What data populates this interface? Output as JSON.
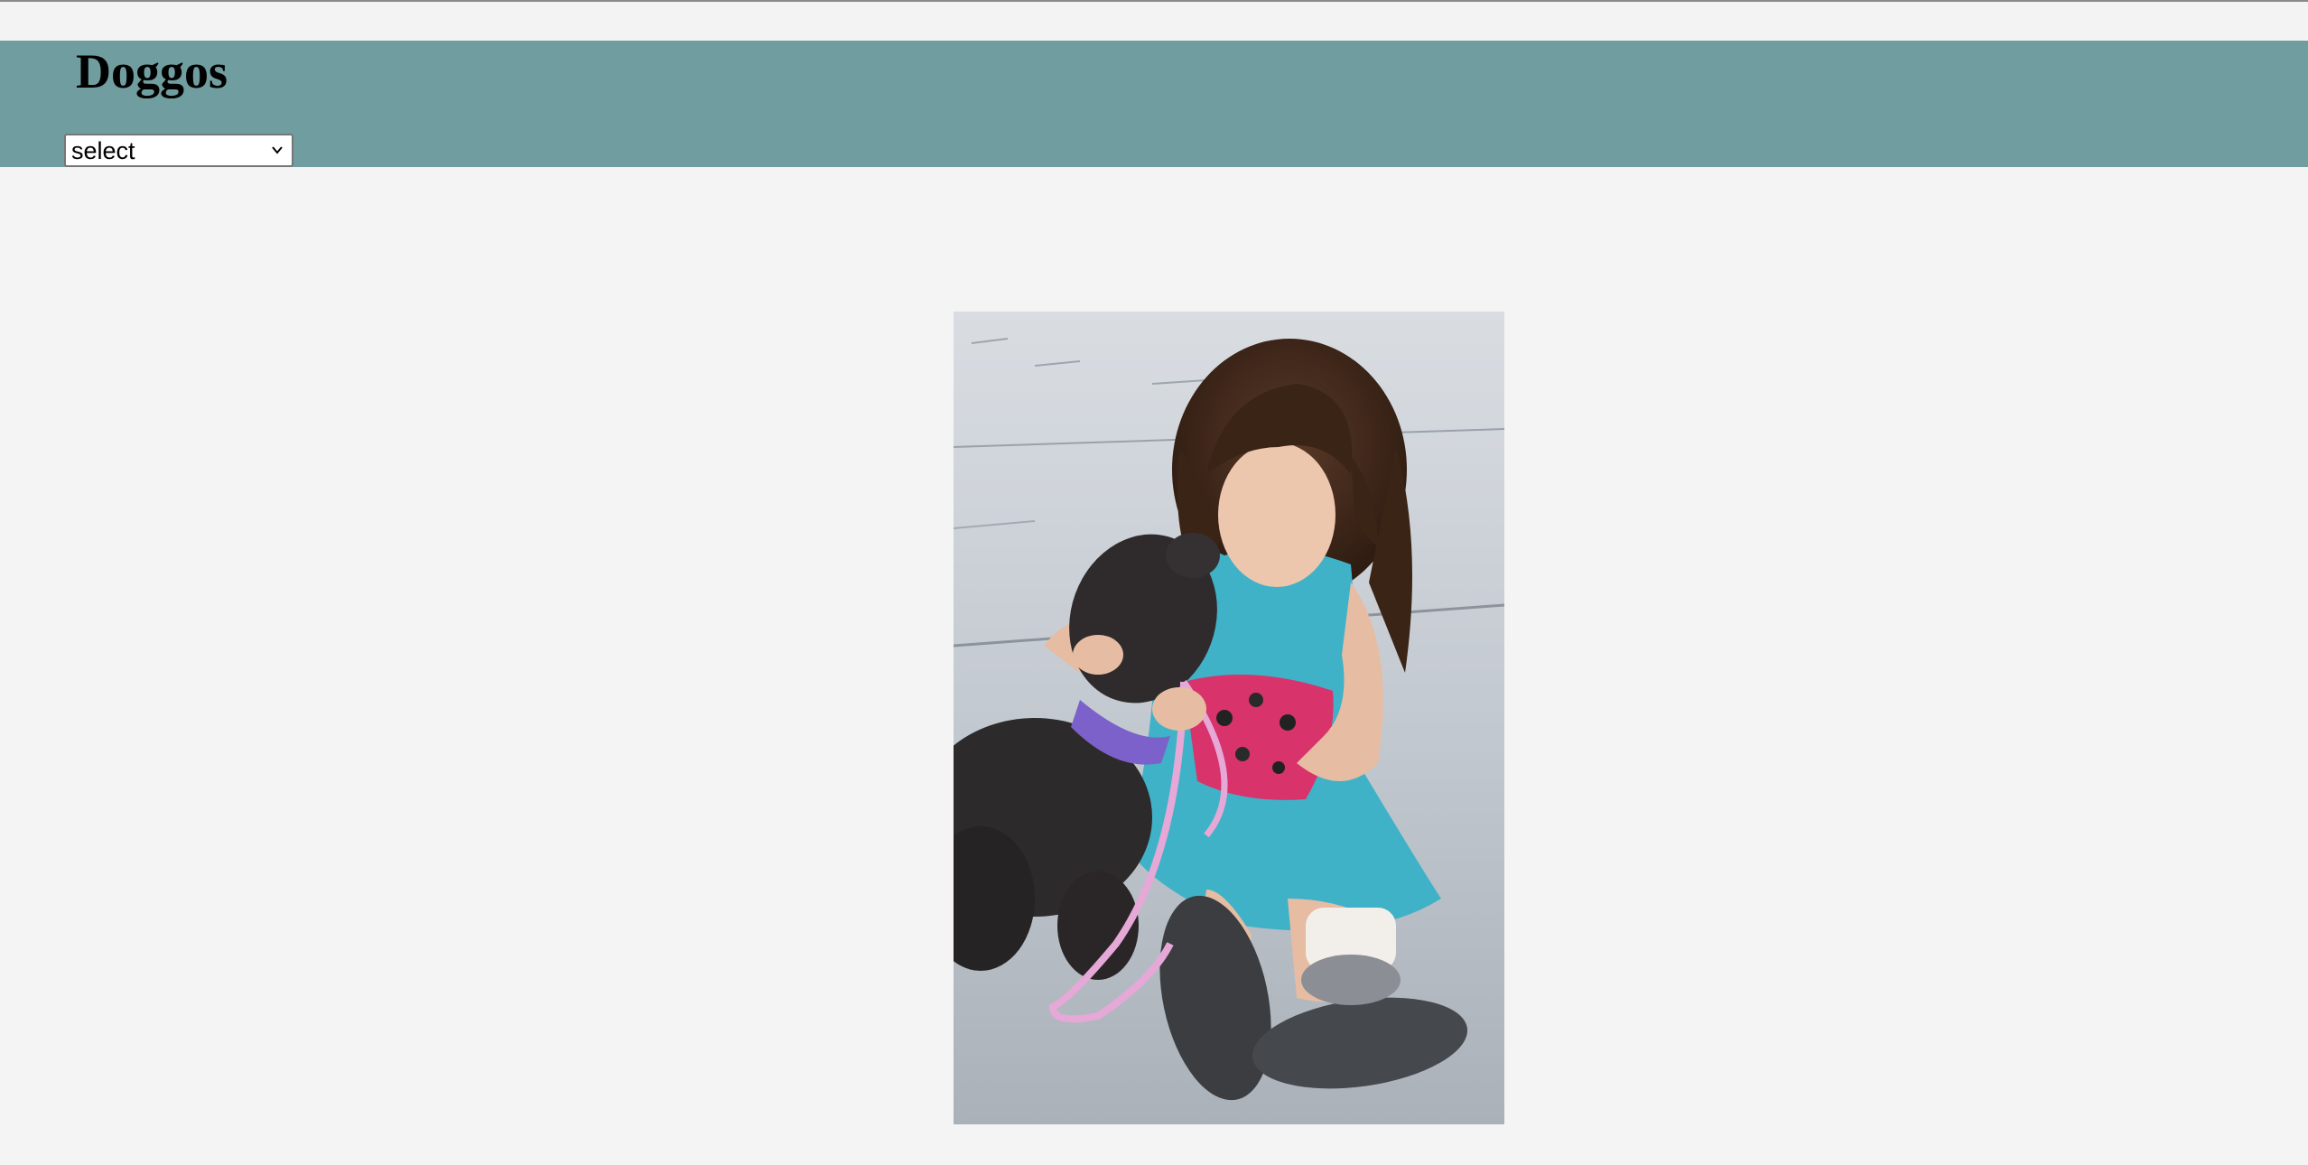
{
  "app": {
    "title": "Doggos"
  },
  "breed_select": {
    "selected_value": "select",
    "icon": "chevron-down-icon"
  },
  "photo": {
    "subject": "girl-with-puppy-photo"
  },
  "colors": {
    "header_bg": "#709d9f",
    "page_bg": "#f4f4f4"
  }
}
